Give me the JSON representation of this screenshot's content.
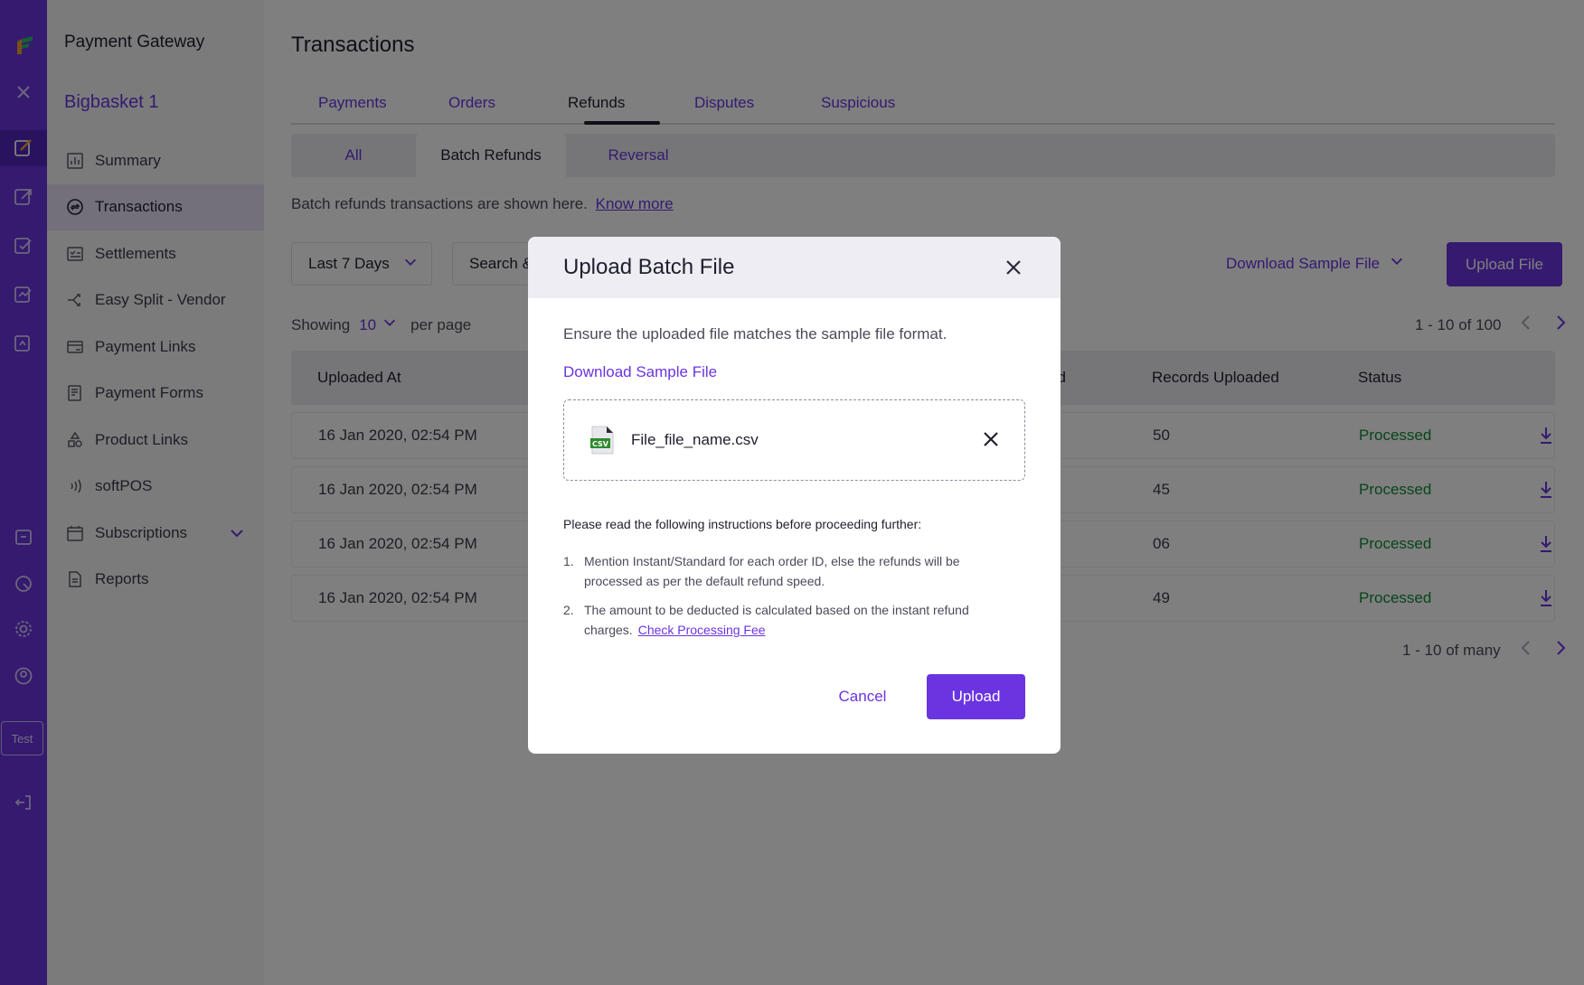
{
  "sidebar": {
    "product_title": "Payment Gateway",
    "merchant_name": "Bigbasket 1",
    "items": [
      {
        "label": "Summary",
        "icon": "bar-chart-icon"
      },
      {
        "label": "Transactions",
        "icon": "exchange-icon"
      },
      {
        "label": "Settlements",
        "icon": "settlement-icon"
      },
      {
        "label": "Easy Split -  Vendor",
        "icon": "split-icon"
      },
      {
        "label": "Payment Links",
        "icon": "payment-link-icon"
      },
      {
        "label": "Payment Forms",
        "icon": "form-icon"
      },
      {
        "label": "Product Links",
        "icon": "product-icon"
      },
      {
        "label": "softPOS",
        "icon": "contactless-icon"
      },
      {
        "label": "Subscriptions",
        "icon": "calendar-icon"
      },
      {
        "label": "Reports",
        "icon": "document-icon"
      }
    ],
    "active_item": "Transactions"
  },
  "rail": {
    "env_chip": "Test"
  },
  "main": {
    "page_title": "Transactions",
    "tabs": [
      "Payments",
      "Orders",
      "Refunds",
      "Disputes",
      "Suspicious"
    ],
    "active_tab": "Refunds",
    "subtabs": [
      "All",
      "Batch Refunds",
      "Reversal"
    ],
    "active_subtab": "Batch Refunds",
    "info_text": "Batch refunds transactions are shown here.",
    "info_link": "Know more",
    "date_filter": "Last 7 Days",
    "search_placeholder": "Search &",
    "download_sample": "Download Sample File",
    "upload_file": "Upload File",
    "showing_label": "Showing",
    "per_page_value": "10",
    "per_page_label": "per page",
    "pager_top": "1 - 10 of 100",
    "pager_bottom": "1 - 10 of many",
    "table": {
      "headers": [
        "Uploaded At",
        "ed",
        "Records Uploaded",
        "Status"
      ],
      "rows": [
        {
          "uploaded_at": "16 Jan 2020, 02:54 PM",
          "records": "50",
          "status": "Processed"
        },
        {
          "uploaded_at": "16 Jan 2020, 02:54 PM",
          "records": "45",
          "status": "Processed"
        },
        {
          "uploaded_at": "16 Jan 2020, 02:54 PM",
          "records": "06",
          "status": "Processed"
        },
        {
          "uploaded_at": "16 Jan 2020, 02:54 PM",
          "records": "49",
          "status": "Processed"
        }
      ]
    }
  },
  "modal": {
    "title": "Upload Batch File",
    "subtitle": "Ensure the uploaded file matches the sample file format.",
    "download_link": "Download Sample File",
    "file_badge": "CSV",
    "file_name": "File_file_name.csv",
    "instructions_title": "Please read the following instructions before proceeding further:",
    "instructions": [
      {
        "num": "1.",
        "text": "Mention Instant/Standard for each order ID, else the refunds will be processed as per the default refund speed.",
        "link": ""
      },
      {
        "num": "2.",
        "text": "The amount to be deducted is calculated based on the instant refund charges.",
        "link": "Check Processing Fee"
      }
    ],
    "cancel_label": "Cancel",
    "upload_label": "Upload"
  },
  "colors": {
    "brand": "#6a34e0",
    "status_processed": "#0f8a37",
    "overlay": "rgba(0,0,0,0.5)"
  }
}
